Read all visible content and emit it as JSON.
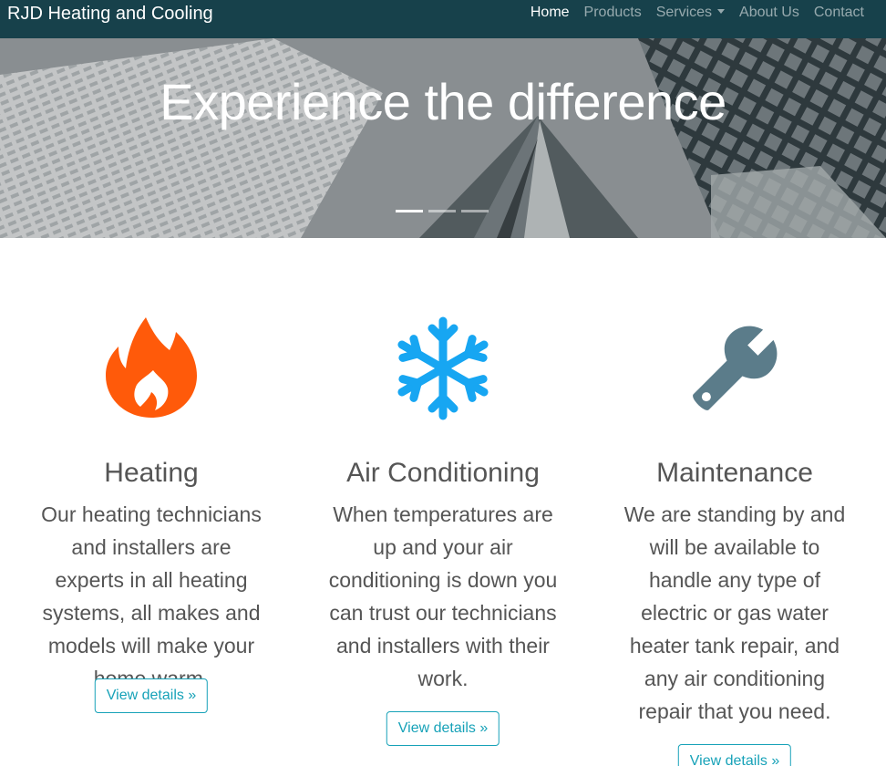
{
  "brand": "RJD Heating and Cooling",
  "nav": [
    {
      "label": "Home"
    },
    {
      "label": "Products"
    },
    {
      "label": "Services"
    },
    {
      "label": "About Us"
    },
    {
      "label": "Contact"
    }
  ],
  "hero": {
    "title": "Experience the difference",
    "active_slide": 1,
    "slide_count": 3
  },
  "features": [
    {
      "icon": "fire-icon",
      "icon_color": "#ff5a0a",
      "title": "Heating",
      "text": "Our heating technicians and installers are experts in all heating systems, all makes and models will make your home warm.",
      "button": "View details »"
    },
    {
      "icon": "snowflake-icon",
      "icon_color": "#17a6f2",
      "title": "Air Conditioning",
      "text": "When temperatures are up and your air conditioning is down you can trust our technicians and installers with their work.",
      "button": "View details »"
    },
    {
      "icon": "wrench-icon",
      "icon_color": "#5b7c8a",
      "title": "Maintenance",
      "text": "We are standing by and will be available to handle any type of electric or gas water heater tank repair, and any air conditioning repair that you need.",
      "button": "View details »"
    }
  ],
  "colors": {
    "navbar": "#17414b",
    "accent": "#17a2b8",
    "text": "#555555"
  }
}
